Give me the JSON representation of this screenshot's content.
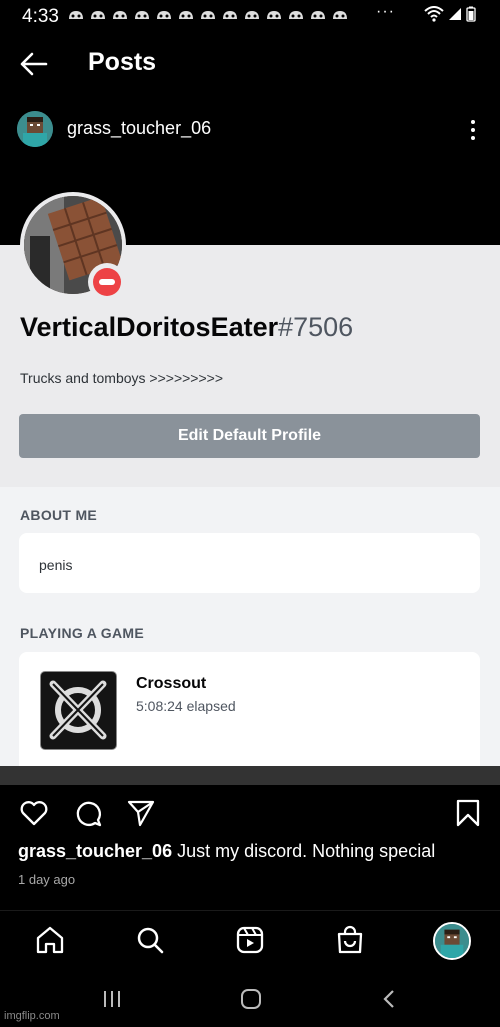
{
  "status": {
    "time": "4:33",
    "more": "···"
  },
  "header": {
    "title": "Posts"
  },
  "post": {
    "author": "grass_toucher_06",
    "caption_author": "grass_toucher_06",
    "caption_text": " Just my discord. Nothing special",
    "date": "1 day ago"
  },
  "discord": {
    "username": "VerticalDoritosEater",
    "discriminator": "#7506",
    "bio": "Trucks and tomboys >>>>>>>>>",
    "edit_button": "Edit Default Profile",
    "about_heading": "ABOUT ME",
    "about_text": "penis",
    "playing_heading": "PLAYING A GAME",
    "game_name": "Crossout",
    "game_elapsed": "5:08:24 elapsed",
    "status": "do-not-disturb"
  },
  "icons": {
    "back": "arrow-left-icon",
    "more": "more-vertical-icon",
    "like": "heart-icon",
    "comment": "comment-icon",
    "share": "send-icon",
    "save": "bookmark-icon",
    "home": "home-icon",
    "search": "search-icon",
    "reels": "reels-icon",
    "shop": "shop-icon"
  },
  "watermark": "imgflip.com",
  "colors": {
    "dnd": "#ed4245",
    "button": "#8a929a"
  }
}
